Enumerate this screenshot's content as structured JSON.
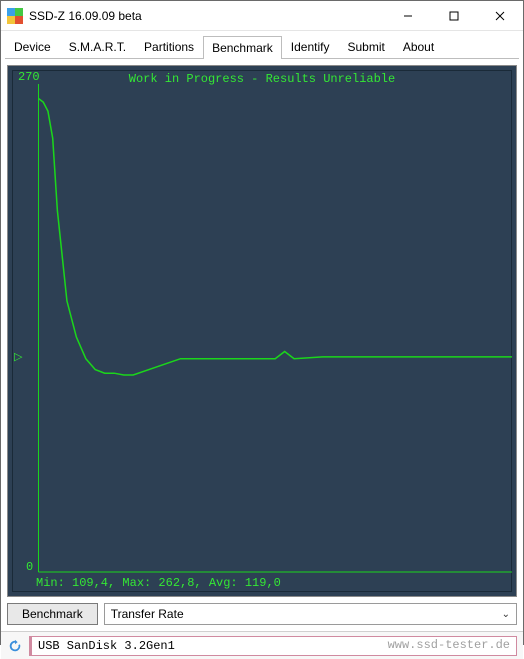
{
  "window": {
    "title": "SSD-Z 16.09.09 beta"
  },
  "tabs": {
    "items": [
      {
        "label": "Device"
      },
      {
        "label": "S.M.A.R.T."
      },
      {
        "label": "Partitions"
      },
      {
        "label": "Benchmark"
      },
      {
        "label": "Identify"
      },
      {
        "label": "Submit"
      },
      {
        "label": "About"
      }
    ],
    "active_index": 3
  },
  "chart": {
    "title": "Work in Progress - Results Unreliable",
    "y_max_label": "270",
    "y_min_label": "0",
    "stats_text": "Min: 109,4, Max: 262,8, Avg: 119,0",
    "marker_glyph": "▷"
  },
  "controls": {
    "button_label": "Benchmark",
    "select_value": "Transfer Rate"
  },
  "statusbar": {
    "drive_text": "USB SanDisk 3.2Gen1",
    "watermark": "www.ssd-tester.de"
  },
  "chart_data": {
    "type": "line",
    "title": "Work in Progress - Results Unreliable",
    "ylabel": "Transfer Rate",
    "xlabel": "",
    "ylim": [
      0,
      270
    ],
    "min": 109.4,
    "max": 262.8,
    "avg": 119.0,
    "series": [
      {
        "name": "Transfer Rate",
        "x": [
          0,
          1,
          2,
          3,
          4,
          6,
          8,
          10,
          12,
          14,
          16,
          18,
          20,
          30,
          40,
          50,
          52,
          54,
          60,
          70,
          80,
          90,
          100
        ],
        "values": [
          262,
          260,
          255,
          240,
          200,
          150,
          130,
          118,
          112,
          110,
          110,
          109,
          109,
          118,
          118,
          118,
          122,
          118,
          119,
          119,
          119,
          119,
          119
        ]
      }
    ]
  }
}
